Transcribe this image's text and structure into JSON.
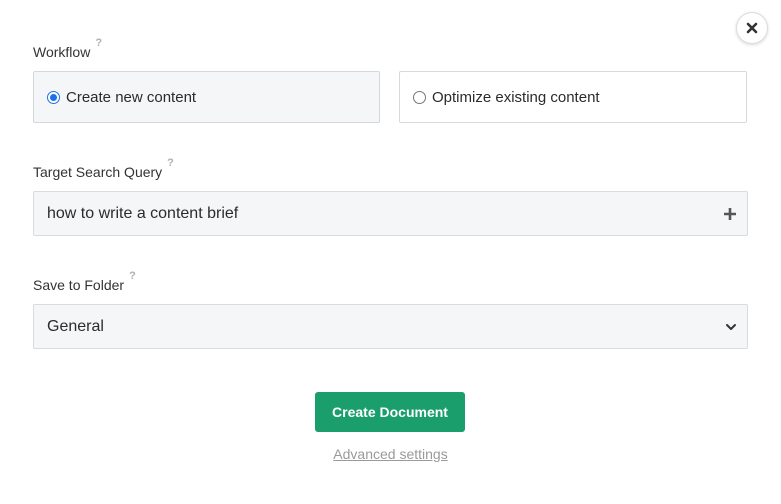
{
  "close": {
    "icon": "close-icon"
  },
  "workflow": {
    "label": "Workflow",
    "help": "?",
    "options": [
      {
        "label": "Create new content",
        "selected": true
      },
      {
        "label": "Optimize existing content",
        "selected": false
      }
    ]
  },
  "query": {
    "label": "Target Search Query",
    "help": "?",
    "value": "how to write a content brief",
    "icon": "plus-icon"
  },
  "folder": {
    "label": "Save to Folder",
    "help": "?",
    "value": "General",
    "icon": "chevron-down-icon"
  },
  "actions": {
    "create_label": "Create Document",
    "advanced_label": "Advanced settings"
  },
  "colors": {
    "primary": "#1a9e6b",
    "radio_accent": "#1a73e8",
    "field_bg": "#f5f6f8"
  }
}
